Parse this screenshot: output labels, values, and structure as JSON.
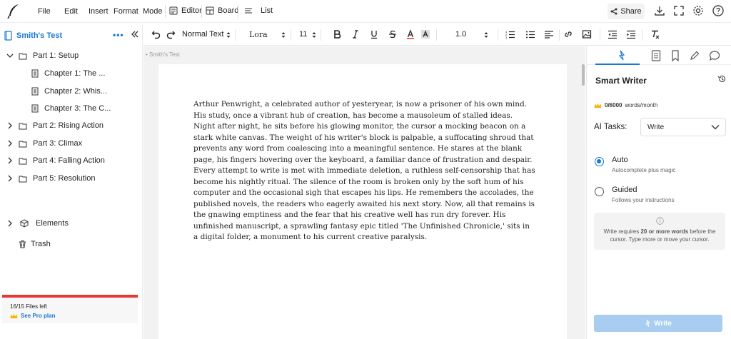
{
  "menubar": {
    "items": [
      "File",
      "Edit",
      "Insert",
      "Format",
      "Mode"
    ],
    "views": [
      "Editor",
      "Board",
      "List"
    ],
    "share_label": "Share"
  },
  "sidebar": {
    "project_title": "Smith's Test",
    "more_label": "•••",
    "tree": [
      {
        "label": "Part 1: Setup",
        "kind": "folder",
        "expanded": true
      },
      {
        "label": "Chapter 1: The ...",
        "kind": "doc"
      },
      {
        "label": "Chapter 2: Whis...",
        "kind": "doc"
      },
      {
        "label": "Chapter 3: The C...",
        "kind": "doc"
      },
      {
        "label": "Part 2: Rising Action",
        "kind": "folder"
      },
      {
        "label": "Part 3: Climax",
        "kind": "folder"
      },
      {
        "label": "Part 4: Falling Action",
        "kind": "folder"
      },
      {
        "label": "Part 5: Resolution",
        "kind": "folder"
      }
    ],
    "elements_label": "Elements",
    "trash_label": "Trash",
    "files_left": "16/15 Files left",
    "pro_link": "See Pro plan"
  },
  "toolbar": {
    "style": "Normal Text",
    "font": "Lora",
    "size": "11",
    "line_spacing": "1.0"
  },
  "editor": {
    "breadcrumb": "Smith's Test",
    "body": "Arthur Penwright, a celebrated author of yesteryear, is now a prisoner of his own mind. His study, once a vibrant hub of creation, has become a mausoleum of stalled ideas. Night after night, he sits before his glowing monitor, the cursor a mocking beacon on a stark white canvas. The weight of his writer's block is palpable, a suffocating shroud that prevents any word from coalescing into a meaningful sentence. He stares at the blank page, his fingers hovering over the keyboard, a familiar dance of frustration and despair. Every attempt to write is met with immediate deletion, a ruthless self-censorship that has become his nightly ritual. The silence of the room is broken only by the soft hum of his computer and the occasional sigh that escapes his lips. He remembers the accolades, the published novels, the readers who eagerly awaited his next story. Now, all that remains is the gnawing emptiness and the fear that his creative well has run dry forever. His unfinished manuscript, a sprawling fantasy epic titled 'The Unfinished Chronicle,' sits in a digital folder, a monument to his current creative paralysis."
  },
  "smart_writer": {
    "title": "Smart Writer",
    "word_count": "0/6000",
    "word_unit": "words/month",
    "ai_tasks_label": "AI Tasks:",
    "ai_task_value": "Write",
    "options": [
      {
        "title": "Auto",
        "desc": "Autocomplete plus magic",
        "selected": true
      },
      {
        "title": "Guided",
        "desc": "Follows your instructions",
        "selected": false
      }
    ],
    "info_pre": "Write requires ",
    "info_bold": "20 or more words",
    "info_post": " before the cursor. Type more or move your cursor.",
    "write_button": "Write"
  },
  "colors": {
    "accent": "#1976d2",
    "warning_bar": "#e53935",
    "write_button_bg": "#a9cdf0",
    "crown": "#f5b400"
  }
}
